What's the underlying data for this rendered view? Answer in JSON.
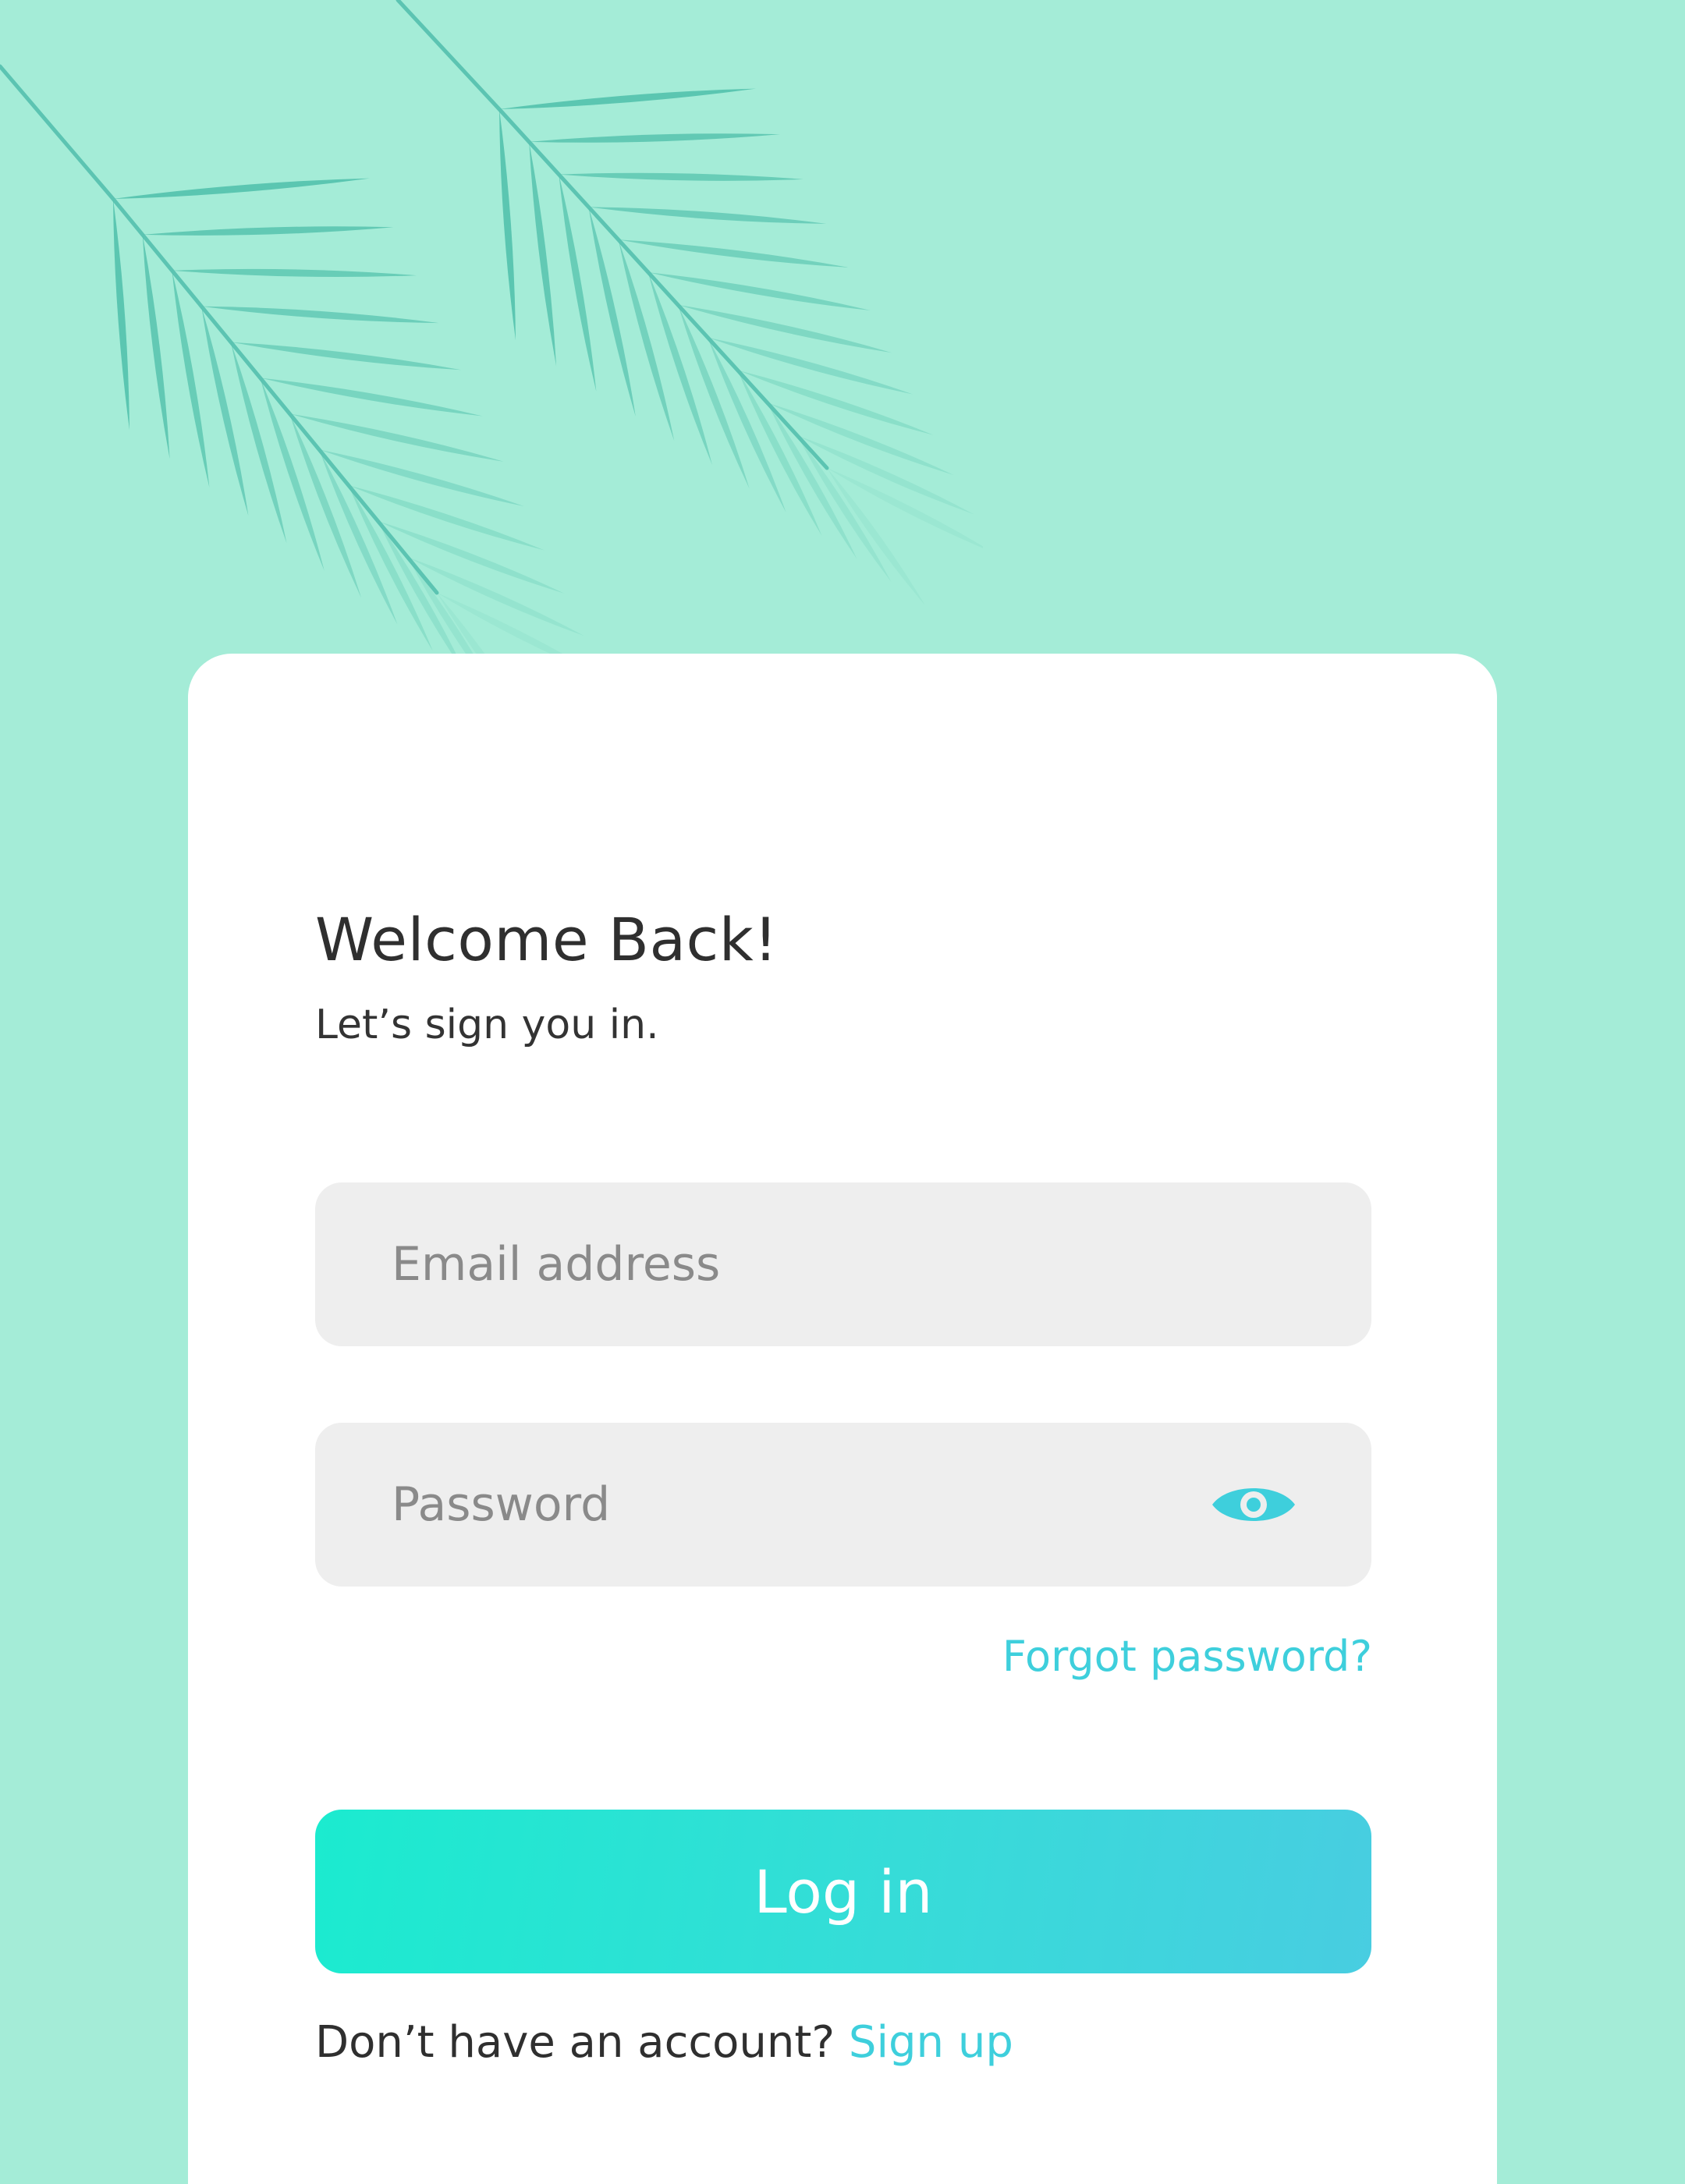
{
  "login": {
    "title": "Welcome Back!",
    "subtitle": "Let’s sign you in.",
    "email_placeholder": "Email address",
    "password_placeholder": "Password",
    "forgot_password": "Forgot password?",
    "login_button": "Log in",
    "no_account_text": "Don’t have an account?",
    "signup_link": "Sign up"
  },
  "icons": {
    "password_toggle": "eye-icon",
    "decoration": "palm-leaf-icon"
  },
  "colors": {
    "background": "#a4ecd7",
    "card": "#ffffff",
    "accent": "#3ecfdc",
    "button_gradient_start": "#1bebcf",
    "button_gradient_end": "#48cde1",
    "field_background": "#eeeeee",
    "leaf": "#5fc7b6"
  }
}
